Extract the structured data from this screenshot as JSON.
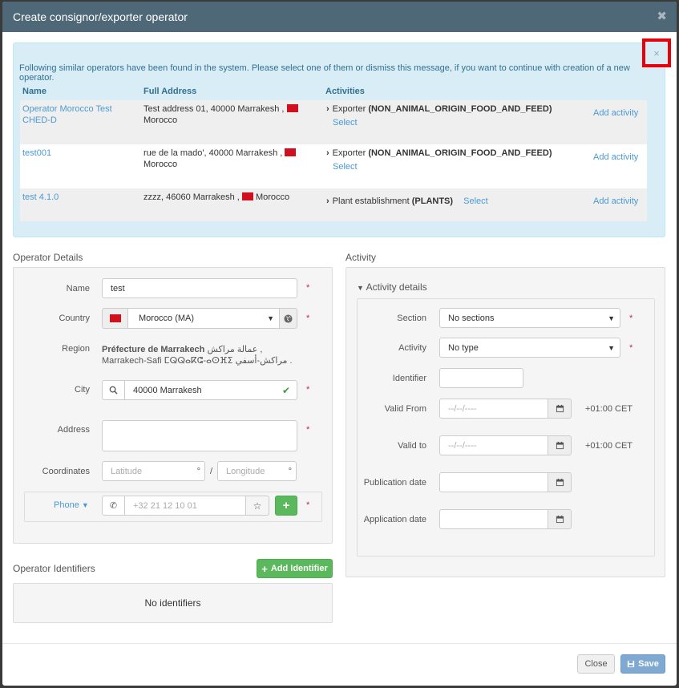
{
  "modal": {
    "title": "Create consignor/exporter operator",
    "close_glyph": "✖"
  },
  "alert": {
    "message": "Following similar operators have been found in the system. Please select one of them or dismiss this message, if you want to continue with creation of a new operator.",
    "close_glyph": "×",
    "headers": {
      "name": "Name",
      "address": "Full Address",
      "activities": "Activities"
    },
    "rows": [
      {
        "name": "Operator Morocco Test CHED-D",
        "address": "Test address 01, 40000 Marrakesh ,",
        "country": "Morocco",
        "activity": "Exporter",
        "activity_code": "(NON_ANIMAL_ORIGIN_FOOD_AND_FEED)",
        "select": "Select",
        "add_activity": "Add activity"
      },
      {
        "name": "test001",
        "address": "rue de la mado', 40000 Marrakesh ,",
        "country": "Morocco",
        "activity": "Exporter",
        "activity_code": "(NON_ANIMAL_ORIGIN_FOOD_AND_FEED)",
        "select": "Select",
        "add_activity": "Add activity"
      },
      {
        "name": "test 4.1.0",
        "address": "zzzz, 46060 Marrakesh ,",
        "country": "Morocco",
        "activity": "Plant establishment",
        "activity_code": "(PLANTS)",
        "select": "Select",
        "add_activity": "Add activity"
      }
    ]
  },
  "operator_details": {
    "title": "Operator Details",
    "name_label": "Name",
    "name_value": "test",
    "country_label": "Country",
    "country_value": "Morocco (MA)",
    "region_label": "Region",
    "region_bold": "Préfecture de Marrakech",
    "region_rest": "عمالة مراكش , Marrakech-Safi ⵎⵕⵕⴰⴽⵛ-ⴰⵙⴼⵉ مراكش-أسفي .",
    "city_label": "City",
    "city_value": "40000 Marrakesh",
    "address_label": "Address",
    "coordinates_label": "Coordinates",
    "latitude_placeholder": "Latitude",
    "longitude_placeholder": "Longitude",
    "coord_sep": "/",
    "degree": "°",
    "phone_label": "Phone",
    "phone_placeholder": "+32 21 12 10 01",
    "required_mark": "*"
  },
  "operator_identifiers": {
    "title": "Operator Identifiers",
    "add_button": "Add Identifier",
    "empty_text": "No identifiers"
  },
  "activity": {
    "title": "Activity",
    "details_title": "Activity details",
    "section_label": "Section",
    "section_value": "No sections",
    "activity_label": "Activity",
    "activity_value": "No type",
    "identifier_label": "Identifier",
    "valid_from_label": "Valid From",
    "valid_to_label": "Valid to",
    "date_placeholder": "--/--/----",
    "timezone": "+01:00 CET",
    "publication_label": "Publication date",
    "application_label": "Application date",
    "required_mark": "*"
  },
  "footer": {
    "close_label": "Close",
    "save_label": "Save"
  },
  "colors": {
    "header_bg": "#4f6877",
    "alert_bg": "#d9edf7",
    "link": "#4a9ad4",
    "success": "#5cb85c",
    "highlight_red": "#e8000b"
  }
}
